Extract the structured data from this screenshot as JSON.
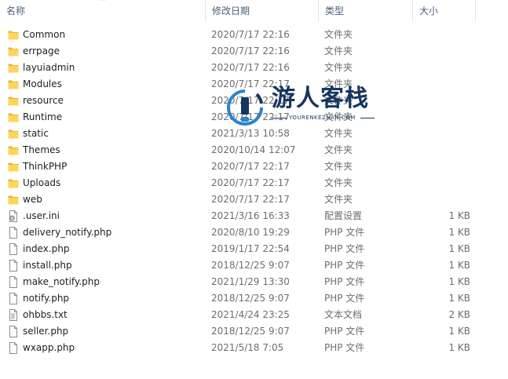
{
  "header": {
    "name": "名称",
    "date": "修改日期",
    "type": "类型",
    "size": "大小",
    "sort_arrow": "^"
  },
  "files": [
    {
      "name": "Common",
      "date": "2020/7/17 22:16",
      "type": "文件夹",
      "size": "",
      "icon": "folder-icon"
    },
    {
      "name": "errpage",
      "date": "2020/7/17 22:16",
      "type": "文件夹",
      "size": "",
      "icon": "folder-icon"
    },
    {
      "name": "layuiadmin",
      "date": "2020/7/17 22:16",
      "type": "文件夹",
      "size": "",
      "icon": "folder-icon"
    },
    {
      "name": "Modules",
      "date": "2020/7/17 22:17",
      "type": "文件夹",
      "size": "",
      "icon": "folder-icon"
    },
    {
      "name": "resource",
      "date": "2020/7/17 22:17",
      "type": "文件夹",
      "size": "",
      "icon": "folder-icon"
    },
    {
      "name": "Runtime",
      "date": "2020/7/17 22:17",
      "type": "文件夹",
      "size": "",
      "icon": "folder-icon"
    },
    {
      "name": "static",
      "date": "2021/3/13 10:58",
      "type": "文件夹",
      "size": "",
      "icon": "folder-icon"
    },
    {
      "name": "Themes",
      "date": "2020/10/14 12:07",
      "type": "文件夹",
      "size": "",
      "icon": "folder-icon"
    },
    {
      "name": "ThinkPHP",
      "date": "2020/7/17 22:17",
      "type": "文件夹",
      "size": "",
      "icon": "folder-icon"
    },
    {
      "name": "Uploads",
      "date": "2020/7/17 22:17",
      "type": "文件夹",
      "size": "",
      "icon": "folder-icon"
    },
    {
      "name": "web",
      "date": "2020/7/17 22:17",
      "type": "文件夹",
      "size": "",
      "icon": "folder-icon"
    },
    {
      "name": ".user.ini",
      "date": "2021/3/16 16:33",
      "type": "配置设置",
      "size": "1 KB",
      "icon": "settings-file-icon"
    },
    {
      "name": "delivery_notify.php",
      "date": "2020/8/10 19:29",
      "type": "PHP 文件",
      "size": "1 KB",
      "icon": "file-icon"
    },
    {
      "name": "index.php",
      "date": "2019/1/17 22:54",
      "type": "PHP 文件",
      "size": "1 KB",
      "icon": "file-icon"
    },
    {
      "name": "install.php",
      "date": "2018/12/25 9:07",
      "type": "PHP 文件",
      "size": "1 KB",
      "icon": "file-icon"
    },
    {
      "name": "make_notify.php",
      "date": "2021/1/29 13:30",
      "type": "PHP 文件",
      "size": "1 KB",
      "icon": "file-icon"
    },
    {
      "name": "notify.php",
      "date": "2018/12/25 9:07",
      "type": "PHP 文件",
      "size": "1 KB",
      "icon": "file-icon"
    },
    {
      "name": "ohbbs.txt",
      "date": "2021/4/24 23:25",
      "type": "文本文档",
      "size": "2 KB",
      "icon": "text-file-icon"
    },
    {
      "name": "seller.php",
      "date": "2018/12/25 9:07",
      "type": "PHP 文件",
      "size": "1 KB",
      "icon": "file-icon"
    },
    {
      "name": "wxapp.php",
      "date": "2021/5/18 7:05",
      "type": "PHP 文件",
      "size": "1 KB",
      "icon": "file-icon"
    }
  ],
  "watermark": {
    "title": "游人客栈",
    "subtitle": "YOURENKEZHAN.COM"
  },
  "colors": {
    "folder": "#ffd45c",
    "folder_dark": "#e8b53a",
    "header_text": "#4c607a",
    "watermark": "#15365f",
    "watermark_accent": "#2a86c9"
  }
}
